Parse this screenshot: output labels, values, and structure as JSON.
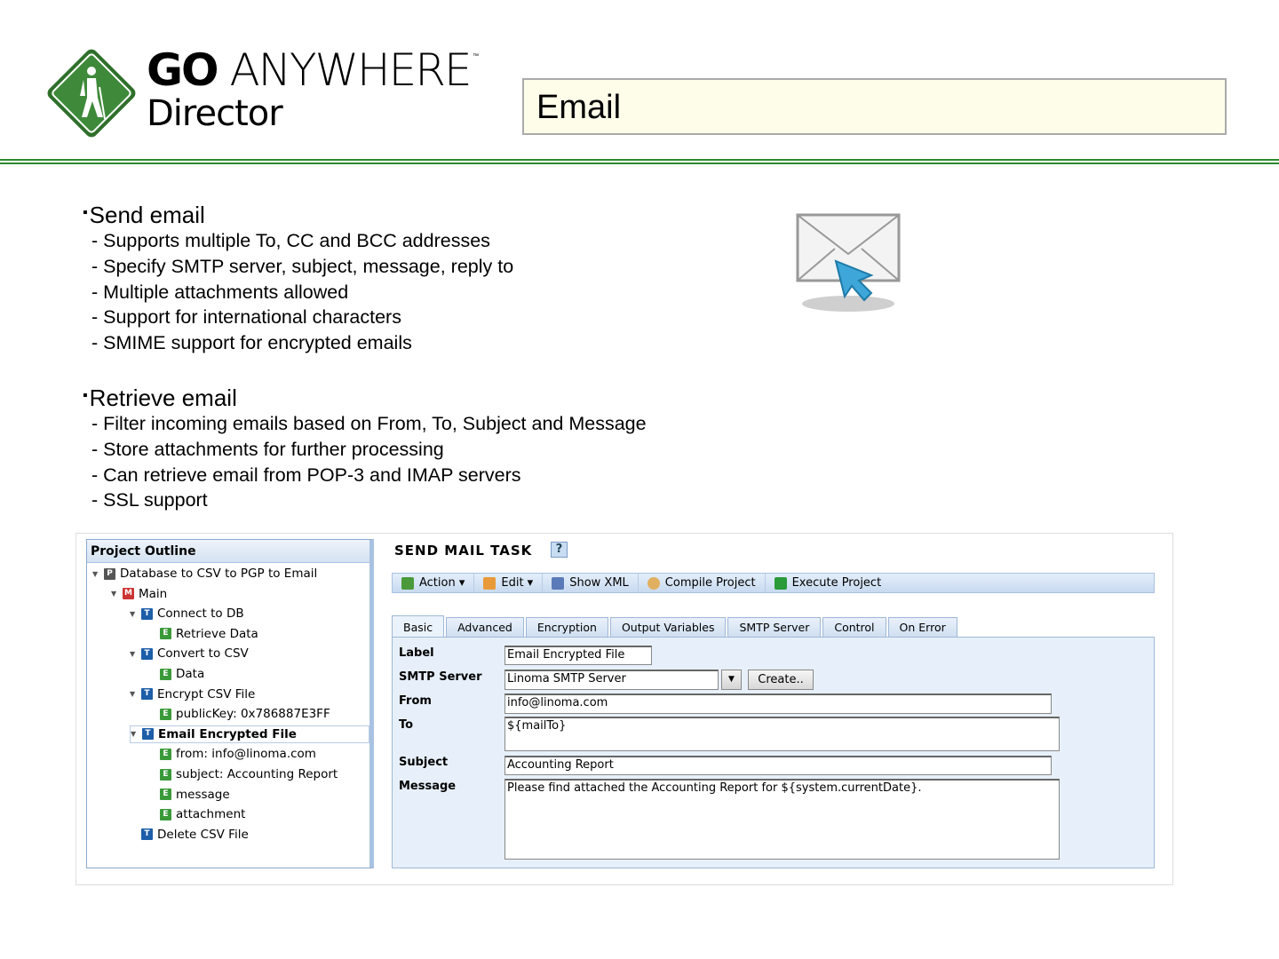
{
  "header": {
    "logo_go": "GO",
    "logo_anywhere": "ANYWHERE",
    "logo_tm": "™",
    "logo_product": "Director",
    "slide_title": "Email"
  },
  "colors": {
    "brand_green": "#2d8a2d",
    "title_bg": "#fdfde9"
  },
  "content": {
    "sections": [
      {
        "heading": "Send email",
        "items": [
          "- Supports multiple To, CC and BCC addresses",
          "- Specify SMTP server, subject, message, reply to",
          "- Multiple attachments allowed",
          "- Support for international characters",
          "- SMIME support for encrypted emails"
        ]
      },
      {
        "heading": "Retrieve email",
        "items": [
          "- Filter incoming emails based on From, To, Subject and Message",
          "- Store attachments for further processing",
          "- Can retrieve email from POP-3 and IMAP servers",
          "- SSL support"
        ]
      }
    ]
  },
  "outline": {
    "title": "Project Outline",
    "nodes": [
      {
        "icon": "P",
        "label": "Database to CSV to PGP to Email"
      },
      {
        "icon": "M",
        "label": "Main"
      },
      {
        "icon": "T",
        "label": "Connect to DB"
      },
      {
        "icon": "E",
        "label": "Retrieve Data"
      },
      {
        "icon": "T",
        "label": "Convert to CSV"
      },
      {
        "icon": "E",
        "label": "Data"
      },
      {
        "icon": "T",
        "label": "Encrypt CSV File"
      },
      {
        "icon": "E",
        "label": "publicKey: 0x786887E3FF"
      },
      {
        "icon": "T",
        "label": "Email Encrypted File"
      },
      {
        "icon": "E",
        "label": "from: info@linoma.com"
      },
      {
        "icon": "E",
        "label": "subject: Accounting Report"
      },
      {
        "icon": "E",
        "label": "message"
      },
      {
        "icon": "E",
        "label": "attachment"
      },
      {
        "icon": "T",
        "label": "Delete CSV File"
      }
    ]
  },
  "task": {
    "title": "SEND MAIL TASK",
    "help": "?",
    "toolbar": [
      "Action ▾",
      "Edit ▾",
      "Show XML",
      "Compile Project",
      "Execute Project"
    ],
    "tabs": [
      "Basic",
      "Advanced",
      "Encryption",
      "Output Variables",
      "SMTP Server",
      "Control",
      "On Error"
    ],
    "form": {
      "label_l": "Label",
      "label_v": "Email Encrypted File",
      "smtp_l": "SMTP Server",
      "smtp_v": "Linoma SMTP Server",
      "create": "Create..",
      "from_l": "From",
      "from_v": "info@linoma.com",
      "to_l": "To",
      "to_v": "${mailTo}",
      "subject_l": "Subject",
      "subject_v": "Accounting Report",
      "message_l": "Message",
      "message_v": "Please find attached the Accounting Report for ${system.currentDate}."
    }
  }
}
